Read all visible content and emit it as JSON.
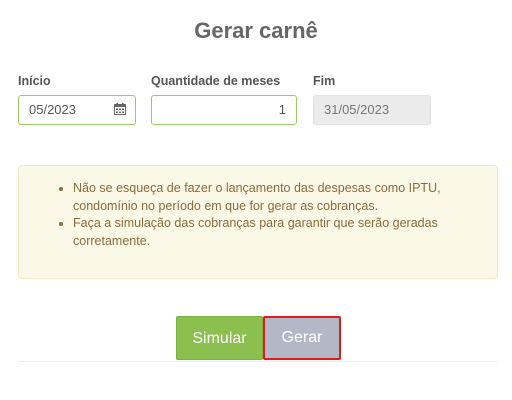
{
  "page": {
    "title": "Gerar carnê"
  },
  "form": {
    "inicio": {
      "label": "Início",
      "value": "05/2023"
    },
    "quantidade": {
      "label": "Quantidade de meses",
      "value": "1"
    },
    "fim": {
      "label": "Fim",
      "value": "31/05/2023"
    }
  },
  "alert": {
    "items": [
      "Não se esqueça de fazer o lançamento das despesas como IPTU, condomínio no período em que for gerar as cobranças.",
      "Faça a simulação das cobranças para garantir que serão geradas corretamente."
    ]
  },
  "actions": {
    "simular_label": "Simular",
    "gerar_label": "Gerar"
  },
  "colors": {
    "primary": "#8bbf4e",
    "disabled_button": "#b4b8c6",
    "highlight": "#e01b1b",
    "alert_bg": "#fcf8e8"
  },
  "icons": {
    "calendar": "calendar-icon"
  }
}
